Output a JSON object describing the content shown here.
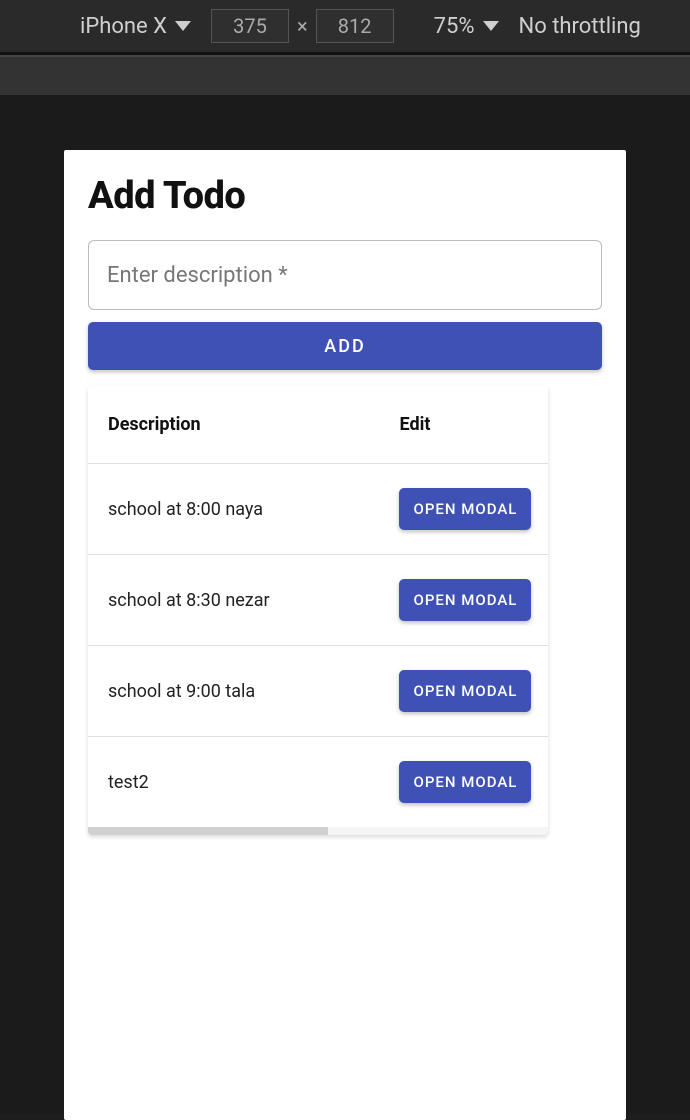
{
  "devtools": {
    "device": "iPhone X",
    "width": "375",
    "height": "812",
    "separator": "×",
    "zoom": "75%",
    "throttling": "No throttling"
  },
  "app": {
    "title": "Add Todo",
    "input_placeholder": "Enter description *",
    "add_button": "ADD",
    "table": {
      "headers": {
        "description": "Description",
        "edit": "Edit"
      },
      "edit_button_label": "OPEN MODAL",
      "rows": [
        {
          "description": "school at 8:00 naya"
        },
        {
          "description": "school at 8:30 nezar"
        },
        {
          "description": "school at 9:00 tala"
        },
        {
          "description": "test2"
        }
      ]
    }
  }
}
